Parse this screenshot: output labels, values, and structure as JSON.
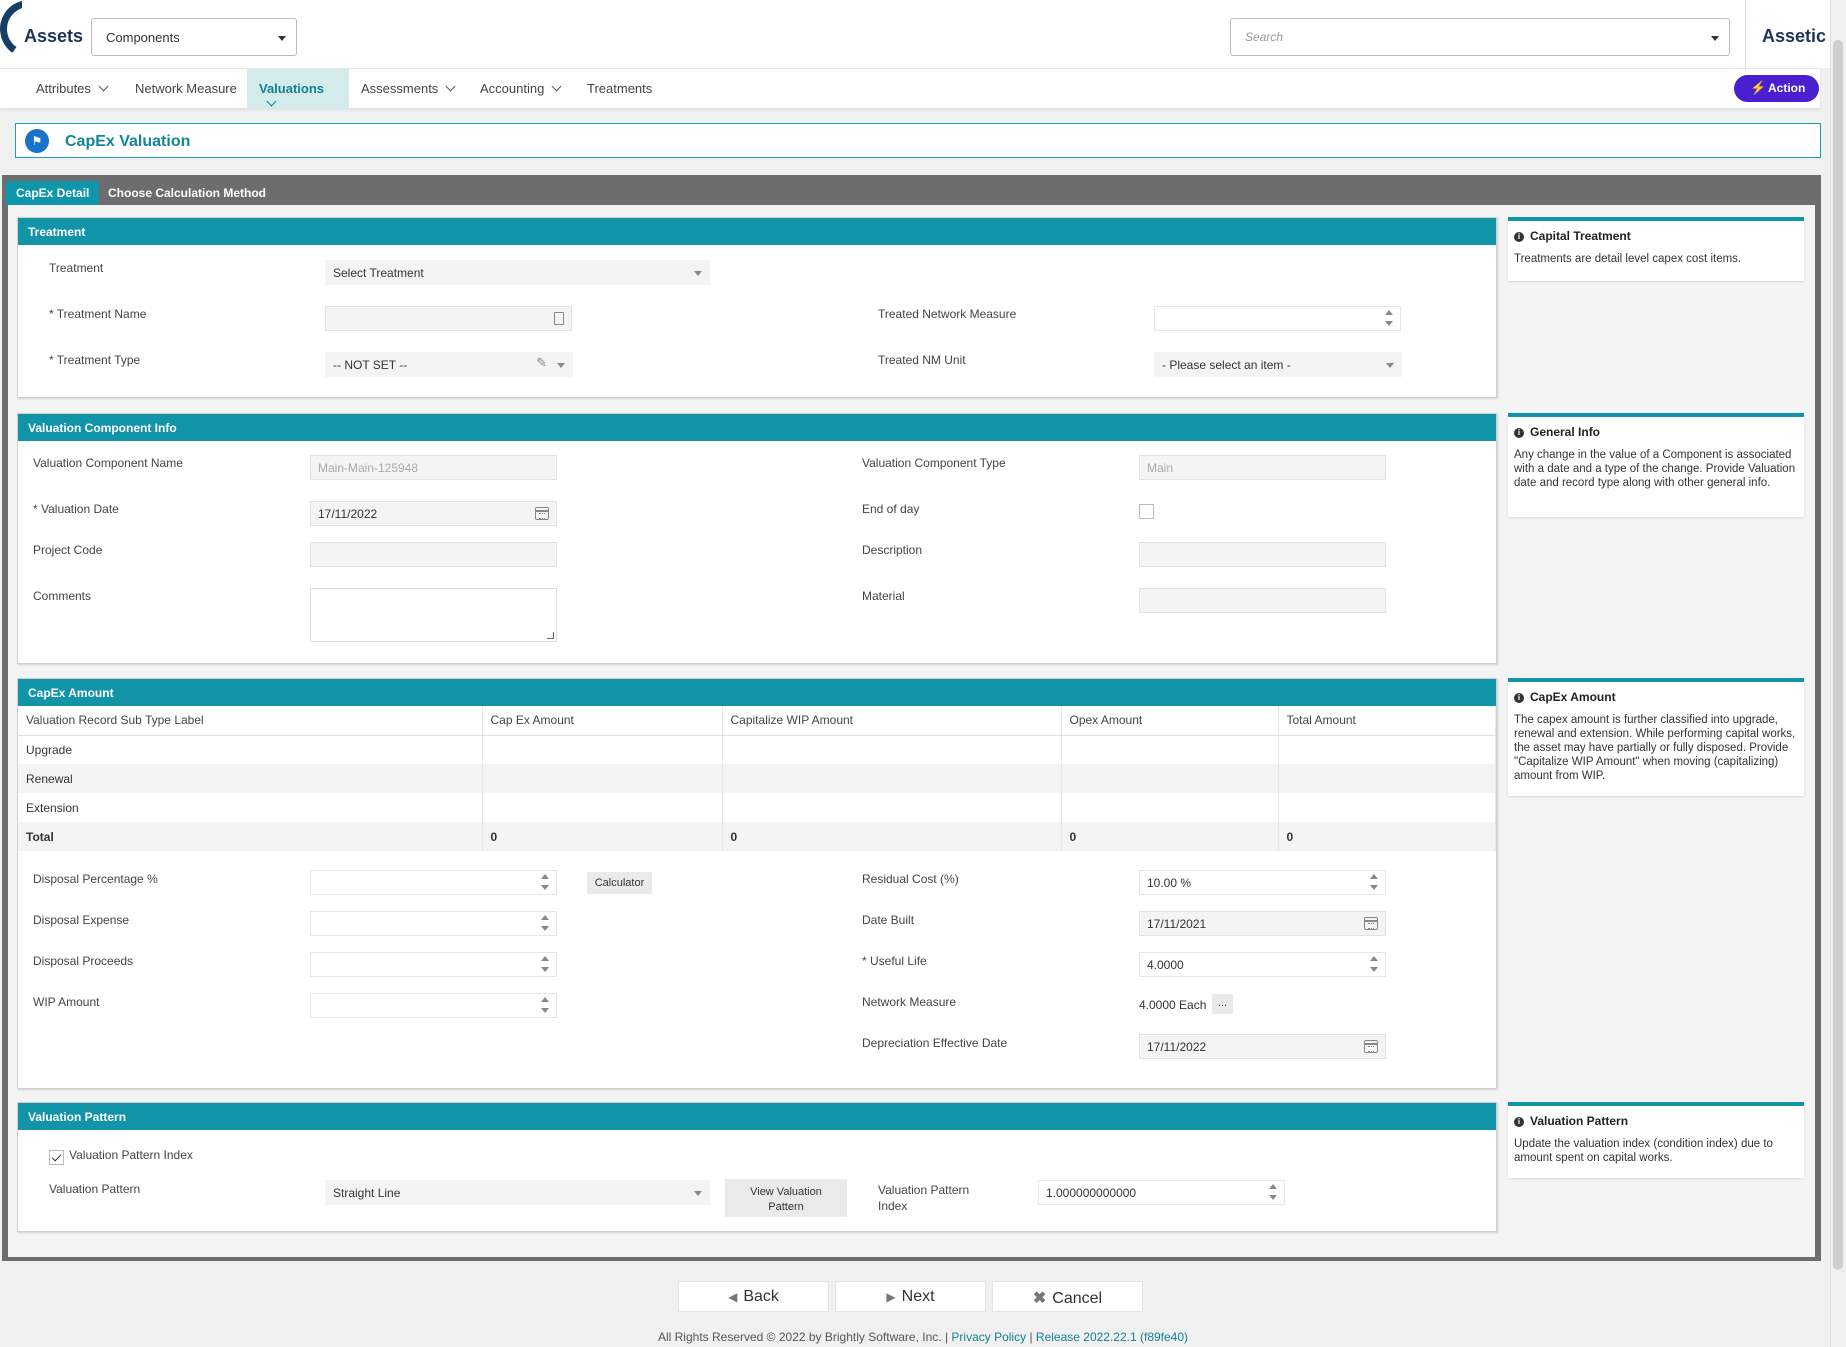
{
  "header": {
    "brand": "Assets",
    "component_select": "Components",
    "search_placeholder": "Search",
    "product": "Assetic"
  },
  "nav": {
    "items": [
      {
        "label": "Attributes",
        "dropdown": true
      },
      {
        "label": "Network Measure",
        "dropdown": false
      },
      {
        "label": "Valuations",
        "dropdown": true,
        "active": true
      },
      {
        "label": "Assessments",
        "dropdown": true
      },
      {
        "label": "Accounting",
        "dropdown": true
      },
      {
        "label": "Treatments",
        "dropdown": false
      }
    ],
    "action_label": "Action"
  },
  "page": {
    "title": "CapEx Valuation"
  },
  "tabs": [
    {
      "label": "CapEx Detail",
      "active": true
    },
    {
      "label": "Choose Calculation Method",
      "active": false
    }
  ],
  "treatment": {
    "header": "Treatment",
    "treatment_label": "Treatment",
    "treatment_value": "Select Treatment",
    "name_label": "* Treatment Name",
    "name_value": "",
    "type_label": "* Treatment Type",
    "type_value": "-- NOT SET --",
    "treated_nm_label": "Treated Network Measure",
    "treated_nm_value": "",
    "treated_unit_label": "Treated NM Unit",
    "treated_unit_value": "- Please select an item -"
  },
  "valuation_info": {
    "header": "Valuation Component Info",
    "component_name_label": "Valuation Component Name",
    "component_name_value": "Main-Main-125948",
    "component_type_label": "Valuation Component Type",
    "component_type_value": "Main",
    "date_label": "* Valuation Date",
    "date_value": "17/11/2022",
    "end_of_day_label": "End of day",
    "end_of_day_checked": false,
    "project_code_label": "Project Code",
    "project_code_value": "",
    "description_label": "Description",
    "description_value": "",
    "comments_label": "Comments",
    "comments_value": "",
    "material_label": "Material",
    "material_value": ""
  },
  "capex": {
    "header": "CapEx Amount",
    "columns": [
      "Valuation Record Sub Type Label",
      "Cap Ex Amount",
      "Capitalize WIP Amount",
      "Opex Amount",
      "Total Amount"
    ],
    "rows": [
      [
        "Upgrade",
        "",
        "",
        "",
        ""
      ],
      [
        "Renewal",
        "",
        "",
        "",
        ""
      ],
      [
        "Extension",
        "",
        "",
        "",
        ""
      ],
      [
        "Total",
        "0",
        "0",
        "0",
        "0"
      ]
    ],
    "disposal_pct_label": "Disposal Percentage %",
    "calculator_label": "Calculator",
    "disposal_expense_label": "Disposal Expense",
    "disposal_proceeds_label": "Disposal Proceeds",
    "wip_label": "WIP Amount",
    "residual_label": "Residual Cost (%)",
    "residual_value": "10.00 %",
    "date_built_label": "Date Built",
    "date_built_value": "17/11/2021",
    "useful_life_label": "* Useful Life",
    "useful_life_value": "4.0000",
    "network_measure_label": "Network Measure",
    "network_measure_value": "4.0000 Each",
    "network_measure_more": "...",
    "dep_date_label": "Depreciation Effective Date",
    "dep_date_value": "17/11/2022"
  },
  "valuation_pattern": {
    "header": "Valuation Pattern",
    "index_checkbox_label": "Valuation Pattern Index",
    "index_checked": true,
    "pattern_label": "Valuation Pattern",
    "pattern_value": "Straight Line",
    "view_button": "View Valuation Pattern",
    "index_label": "Valuation Pattern Index",
    "index_value": "1.000000000000"
  },
  "info_panels": [
    {
      "title": "Capital Treatment",
      "body": "Treatments are detail level capex cost items."
    },
    {
      "title": "General Info",
      "body": "Any change in the value of a Component is associated with a date and a type of the change. Provide Valuation date and record type along with other general info."
    },
    {
      "title": "CapEx Amount",
      "body": "The capex amount is further classified into upgrade, renewal and extension. While performing capital works, the asset may have partially or fully disposed. Provide \"Capitalize WIP Amount\" when moving (capitalizing) amount from WIP."
    },
    {
      "title": "Valuation Pattern",
      "body": "Update the valuation index (condition index) due to amount spent on capital works."
    }
  ],
  "footer_buttons": {
    "back": "Back",
    "next": "Next",
    "cancel": "Cancel"
  },
  "footer": {
    "copyright": "All Rights Reserved © 2022 by Brightly Software, Inc. |",
    "privacy": "Privacy Policy",
    "sep": "|",
    "release": "Release 2022.22.1 (f89fe40)"
  }
}
